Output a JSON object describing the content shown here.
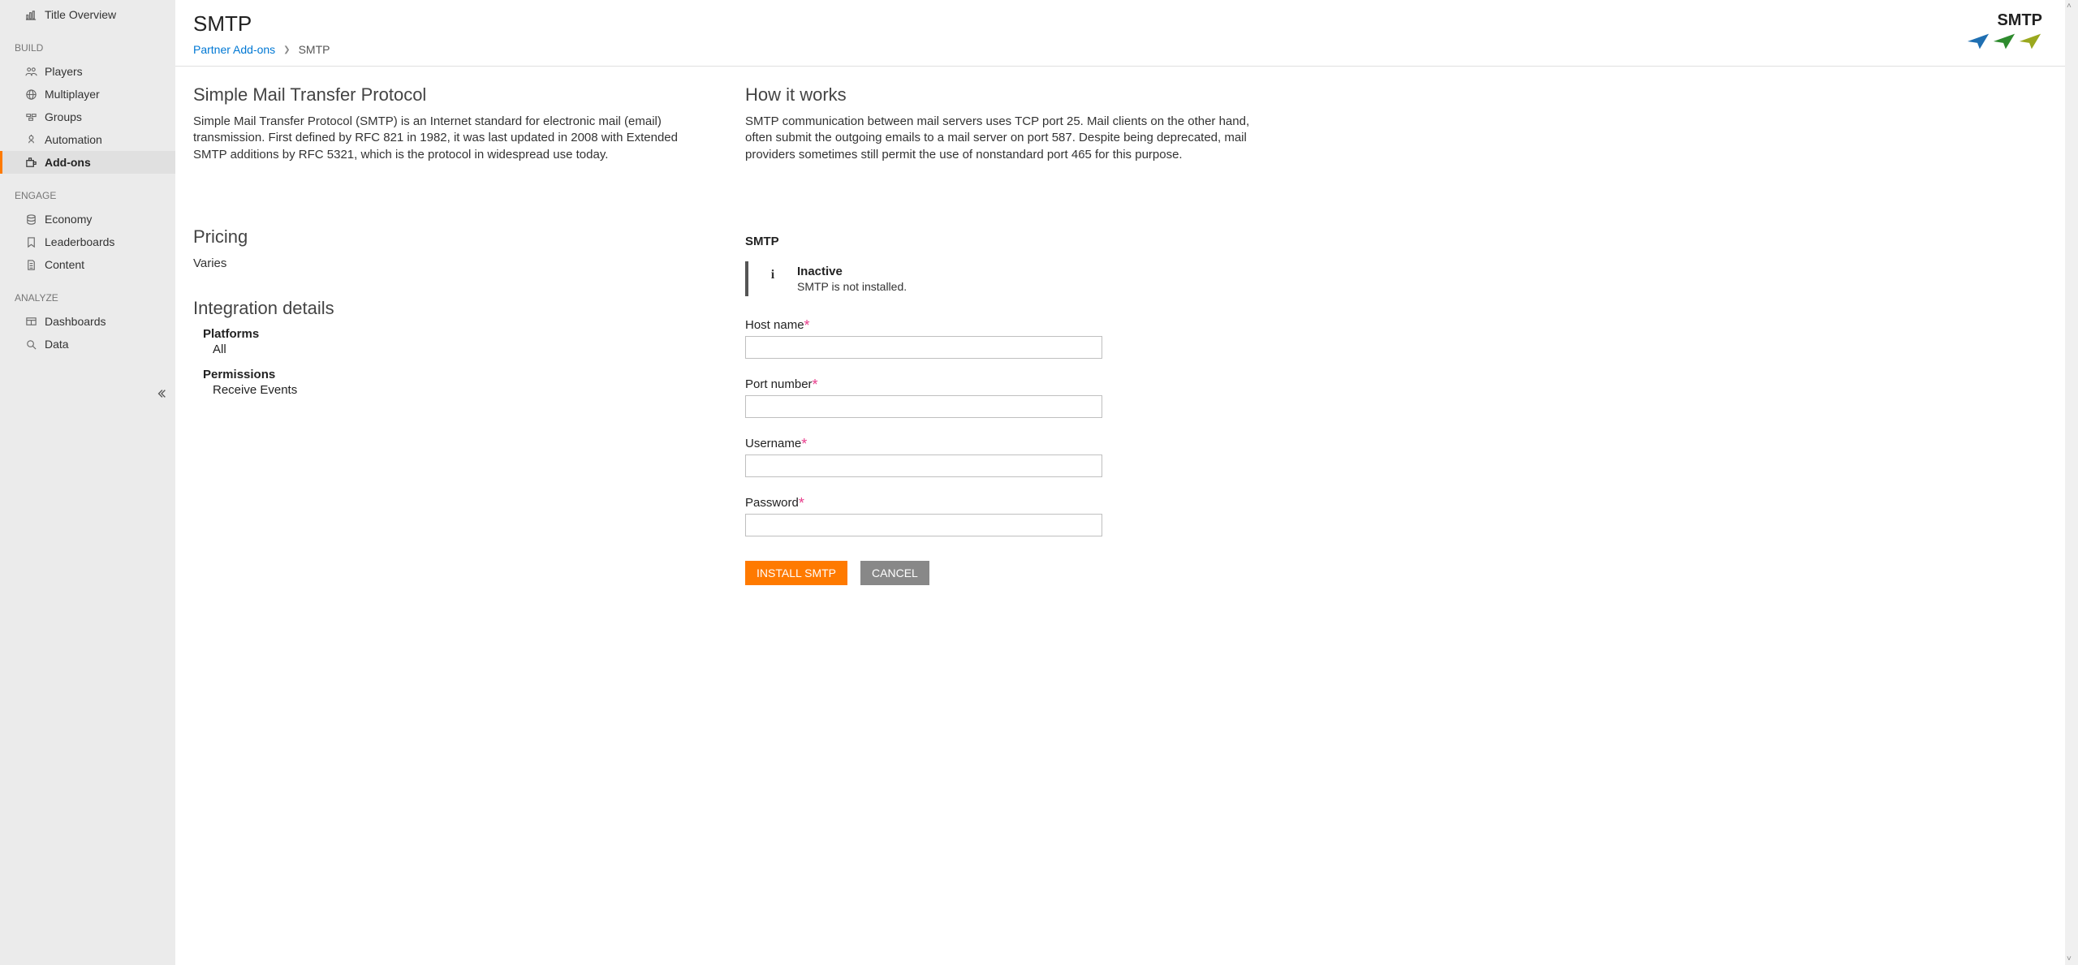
{
  "sidebar": {
    "top_item": "Title Overview",
    "groups": [
      {
        "label": "BUILD",
        "items": [
          "Players",
          "Multiplayer",
          "Groups",
          "Automation",
          "Add-ons"
        ],
        "active": "Add-ons"
      },
      {
        "label": "ENGAGE",
        "items": [
          "Economy",
          "Leaderboards",
          "Content"
        ]
      },
      {
        "label": "ANALYZE",
        "items": [
          "Dashboards",
          "Data"
        ]
      }
    ]
  },
  "header": {
    "title": "SMTP",
    "breadcrumb_link": "Partner Add-ons",
    "breadcrumb_current": "SMTP",
    "logo_text": "SMTP"
  },
  "left": {
    "overview_title": "Simple Mail Transfer Protocol",
    "overview_body": "Simple Mail Transfer Protocol (SMTP) is an Internet standard for electronic mail (email) transmission. First defined by RFC 821 in 1982, it was last updated in 2008 with Extended SMTP additions by RFC 5321, which is the protocol in widespread use today.",
    "pricing_title": "Pricing",
    "pricing_value": "Varies",
    "integration_title": "Integration details",
    "platforms_label": "Platforms",
    "platforms_value": "All",
    "permissions_label": "Permissions",
    "permissions_value": "Receive Events"
  },
  "right": {
    "how_title": "How it works",
    "how_body": "SMTP communication between mail servers uses TCP port 25. Mail clients on the other hand, often submit the outgoing emails to a mail server on port 587. Despite being deprecated, mail providers sometimes still permit the use of nonstandard port 465 for this purpose.",
    "conn_title": "SMTP",
    "status_title": "Inactive",
    "status_msg": "SMTP is not installed.",
    "fields": {
      "host": "Host name",
      "port": "Port number",
      "user": "Username",
      "pass": "Password"
    },
    "install_btn": "INSTALL SMTP",
    "cancel_btn": "CANCEL"
  }
}
